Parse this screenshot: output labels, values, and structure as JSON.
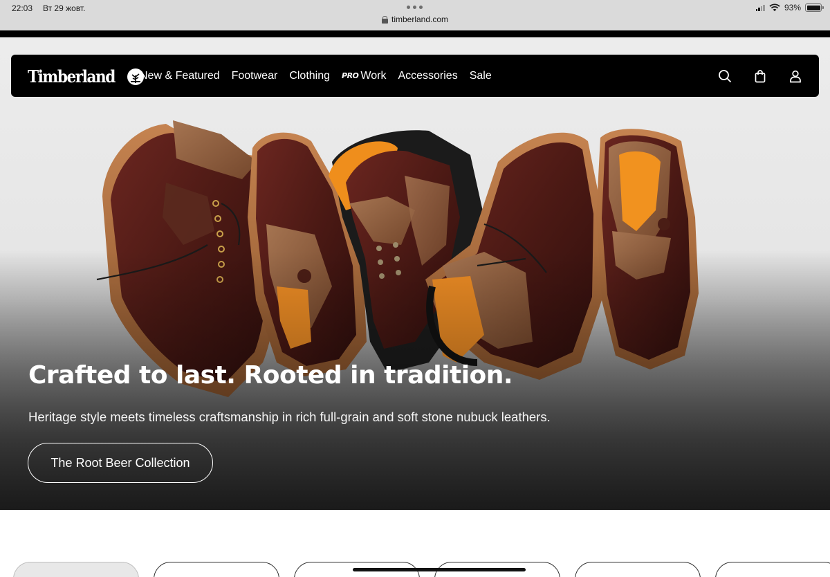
{
  "status_bar": {
    "time": "22:03",
    "date": "Вт 29 жовт.",
    "url": "timberland.com",
    "battery": "93%",
    "icons": [
      "lock-icon",
      "cellular-icon",
      "wifi-icon",
      "battery-icon"
    ]
  },
  "navbar": {
    "brand": "Timberland",
    "links": [
      {
        "label": "New & Featured"
      },
      {
        "label": "Footwear"
      },
      {
        "label": "Clothing"
      },
      {
        "label": "Work",
        "badge": "PRO"
      },
      {
        "label": "Accessories"
      },
      {
        "label": "Sale"
      }
    ],
    "icons": [
      "search-icon",
      "bag-icon",
      "account-icon"
    ]
  },
  "hero": {
    "title": "Crafted to last. Rooted in tradition.",
    "subtitle": "Heritage style meets timeless craftsmanship in rich full-grain and soft stone nubuck leathers.",
    "cta": "The Root Beer Collection"
  },
  "colors": {
    "nav_bg": "#000000",
    "leather": "#4a1a16",
    "nubuck": "#8a5a3c",
    "sole": "#b06f3e",
    "lining": "#f0921e"
  }
}
